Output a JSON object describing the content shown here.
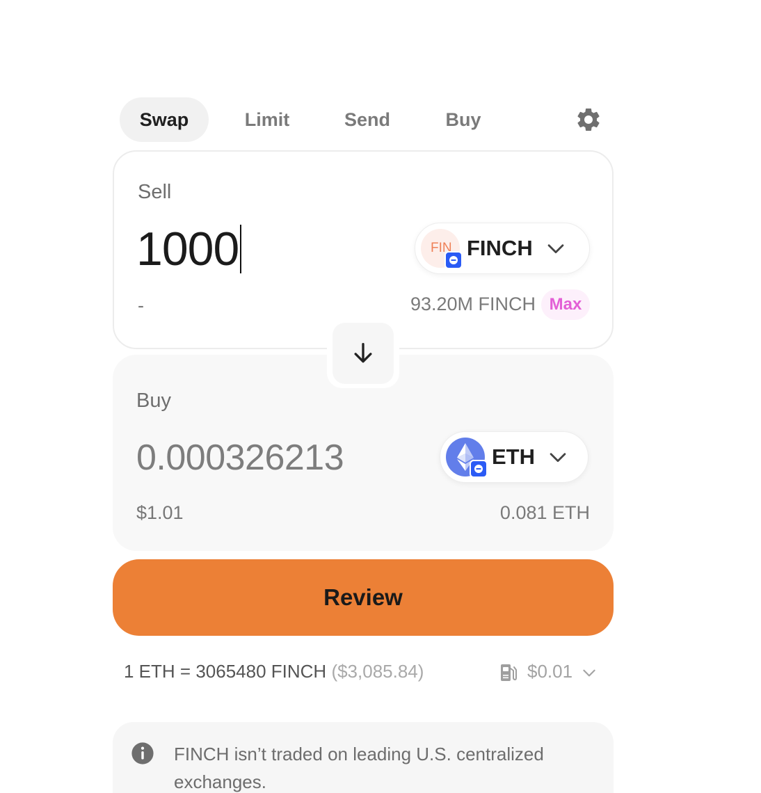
{
  "tabs": [
    {
      "label": "Swap",
      "active": true
    },
    {
      "label": "Limit",
      "active": false
    },
    {
      "label": "Send",
      "active": false
    },
    {
      "label": "Buy",
      "active": false
    }
  ],
  "settings_icon": "gear-icon",
  "sell": {
    "label": "Sell",
    "amount": "1000",
    "usd_value": "-",
    "token": {
      "symbol": "FINCH",
      "icon_text": "FIN",
      "icon": "finch-token-icon",
      "chain_badge": "base-chain-icon"
    },
    "balance": "93.20M FINCH",
    "max_label": "Max"
  },
  "switch_icon": "arrow-down-icon",
  "buy": {
    "label": "Buy",
    "amount": "0.000326213",
    "usd_value": "$1.01",
    "token": {
      "symbol": "ETH",
      "icon": "eth-token-icon",
      "chain_badge": "base-chain-icon"
    },
    "balance": "0.081 ETH"
  },
  "review_label": "Review",
  "rate": {
    "text": "1 ETH = 3065480 FINCH",
    "usd": "($3,085.84)"
  },
  "gas": {
    "icon": "gas-pump-icon",
    "cost": "$0.01"
  },
  "warning": {
    "icon": "info-icon",
    "text": "FINCH isn’t traded on leading U.S. centralized exchanges."
  },
  "colors": {
    "accent": "#ec8036",
    "max_text": "#e35fd6",
    "max_bg": "#fdf0fb",
    "chain_badge": "#2b5bf5",
    "eth": "#627eea"
  }
}
